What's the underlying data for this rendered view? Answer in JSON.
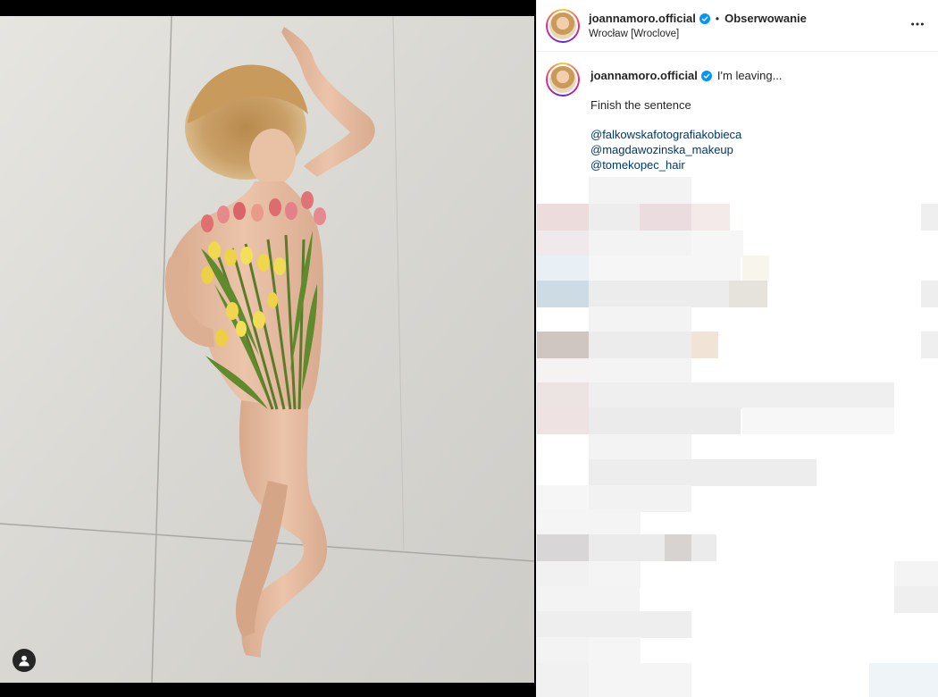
{
  "post": {
    "username": "joannamoro.official",
    "follow_label": "Obserwowanie",
    "location": "Wrocław [Wroclove]",
    "separator": "•"
  },
  "caption": {
    "username": "joannamoro.official",
    "text": "I'm leaving...",
    "paragraph": "Finish the sentence",
    "mentions": [
      "@falkowskafotografiakobieca",
      "@magdawozinska_makeup",
      "@tomekopec_hair"
    ]
  },
  "icons": {
    "verified": "verified-badge-icon",
    "more": "more-options-icon",
    "user_tag": "user-tag-icon"
  },
  "colors": {
    "verified_blue": "#0095f6",
    "mention_link": "#00376b",
    "text": "#262626"
  }
}
